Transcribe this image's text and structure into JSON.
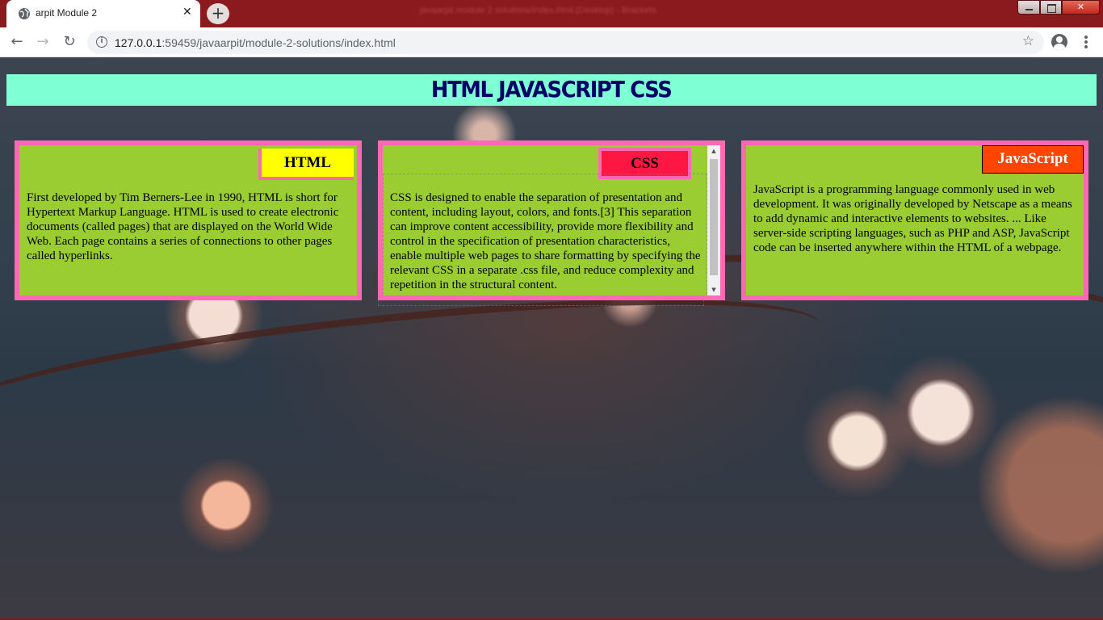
{
  "browser": {
    "tab_title": "arpit Module 2",
    "tab_close": "✕",
    "new_tab": "+",
    "window_title": "javaarpit module 2 solutions/index.html (Desktop) - Brackets",
    "url_host": "127.0.0.1",
    "url_rest": ":59459/javaarpit/module-2-solutions/index.html",
    "icons": {
      "favicon": "globe-icon",
      "back": "arrow-left-icon",
      "forward": "arrow-right-icon",
      "reload": "reload-icon",
      "site_info": "info-icon",
      "bookmark": "star-icon",
      "profile": "account-icon",
      "menu": "more-vertical-icon"
    },
    "glyphs": {
      "back": "←",
      "forward": "→",
      "reload": "↻",
      "info": "i",
      "star": "☆",
      "close": "✕",
      "scroll_up": "▲",
      "scroll_down": "▼"
    }
  },
  "page": {
    "heading": "HTML JAVASCRIPT CSS",
    "colors": {
      "heading_bg": "#7fffd4",
      "heading_text": "#000066",
      "card_bg": "#9acd32",
      "card_border": "#ff69b4",
      "html_label_bg": "#ffff00",
      "css_label_bg": "#ff1744",
      "js_label_bg": "#ff4500"
    },
    "cards": [
      {
        "label": "HTML",
        "text": "First developed by Tim Berners-Lee in 1990, HTML is short for Hypertext Markup Language. HTML is used to create electronic documents (called pages) that are displayed on the World Wide Web. Each page contains a series of connections to other pages called hyperlinks."
      },
      {
        "label": "CSS",
        "text": "CSS is designed to enable the separation of presentation and content, including layout, colors, and fonts.[3] This separation can improve content accessibility, provide more flexibility and control in the specification of presentation characteristics, enable multiple web pages to share formatting by specifying the relevant CSS in a separate .css file, and reduce complexity and repetition in the structural content."
      },
      {
        "label": "JavaScript",
        "text": "JavaScript is a programming language commonly used in web development. It was originally developed by Netscape as a means to add dynamic and interactive elements to websites. ... Like server-side scripting languages, such as PHP and ASP, JavaScript code can be inserted anywhere within the HTML of a webpage."
      }
    ]
  }
}
